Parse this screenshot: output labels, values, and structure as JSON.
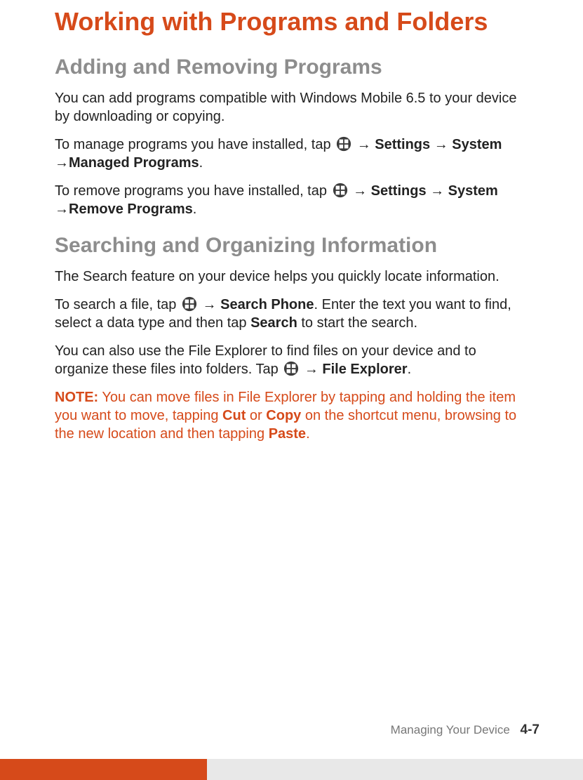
{
  "title": "Working with Programs and Folders",
  "sec1": {
    "heading": "Adding and Removing Programs",
    "p1": "You can add programs compatible with Windows Mobile 6.5 to your device by downloading or copying.",
    "p2_a": "To manage programs you have installed, tap ",
    "p2_b": " Settings ",
    "p2_c": " System ",
    "p2_d": "Managed Programs",
    "p3_a": "To remove programs you have installed, tap ",
    "p3_b": " Settings ",
    "p3_c": " System ",
    "p3_d": "Remove Programs"
  },
  "sec2": {
    "heading": "Searching and Organizing Information",
    "p1": "The Search feature on your device helps you quickly locate information.",
    "p2_a": "To search a file, tap ",
    "p2_b": " Search Phone",
    "p2_c": ". Enter the text you want to find, select a data type and then tap ",
    "p2_d": "Search",
    "p2_e": " to start the search.",
    "p3_a": "You can also use the File Explorer to find files on your device and to organize these files into folders. Tap ",
    "p3_b": " File Explorer"
  },
  "note": {
    "label": "NOTE:",
    "a": " You can move files in File Explorer by tapping and holding the item you want to move, tapping ",
    "b": "Cut",
    "c": " or ",
    "d": "Copy",
    "e": " on the shortcut menu, browsing to the new location and then tapping ",
    "f": "Paste",
    "g": "."
  },
  "footer": {
    "label": "Managing Your Device",
    "page": "4-7"
  },
  "glyph": {
    "arrow": "→"
  }
}
